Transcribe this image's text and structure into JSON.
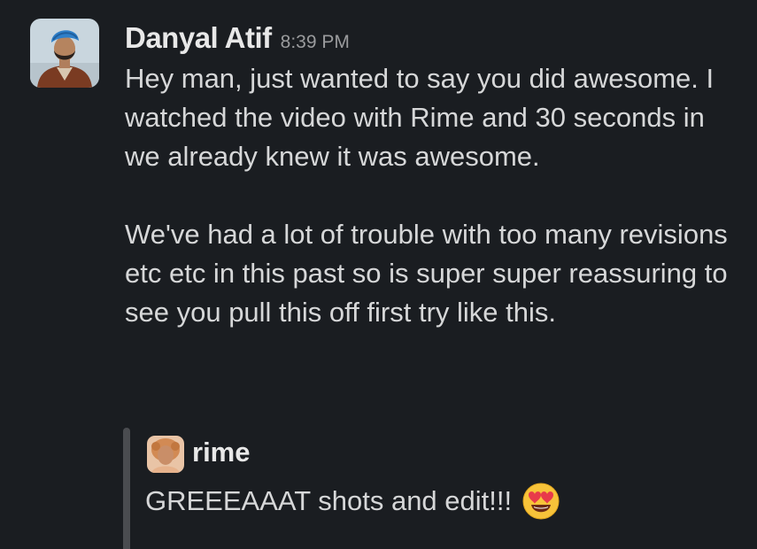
{
  "message": {
    "author": "Danyal Atif",
    "timestamp": "8:39 PM",
    "paragraphs": [
      "Hey man, just wanted to say you did awesome. I watched the video with Rime and 30 seconds in we already knew it was awesome.",
      "We've had a lot of trouble with too many revisions etc etc in this past so is super super reassuring to see you pull this off first try like this."
    ]
  },
  "quote": {
    "author": "rime",
    "text": "GREEEAAAT shots and edit!!!",
    "emoji": "heart-eyes-emoji"
  },
  "colors": {
    "background": "#1a1d21",
    "text": "#d6d7d8",
    "timestamp": "#9a9b9d",
    "quote_bar": "#4a4c50"
  }
}
